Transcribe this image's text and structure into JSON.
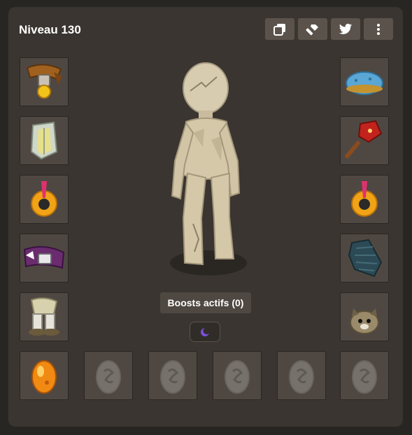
{
  "header": {
    "title": "Niveau 130",
    "buttons": [
      {
        "icon": "copy-icon"
      },
      {
        "icon": "hammer-icon"
      },
      {
        "icon": "twitter-icon"
      },
      {
        "icon": "more-vertical-icon"
      }
    ]
  },
  "equipment": {
    "left": [
      "amulet",
      "shield",
      "ring",
      "belt",
      "boots"
    ],
    "right": [
      "hat",
      "weapon",
      "ring",
      "cloak",
      "pet"
    ],
    "bottom": [
      "dofus-amber",
      "empty-dofus-slot",
      "empty-dofus-slot",
      "empty-dofus-slot",
      "empty-dofus-slot",
      "empty-dofus-slot"
    ]
  },
  "boosts": {
    "label": "Boosts actifs (0)"
  },
  "buff": {
    "icon": "moon-icon"
  },
  "colors": {
    "background": "#282623",
    "panel": "#3a3530",
    "slot": "#4f4842",
    "button": "#5b534b"
  }
}
